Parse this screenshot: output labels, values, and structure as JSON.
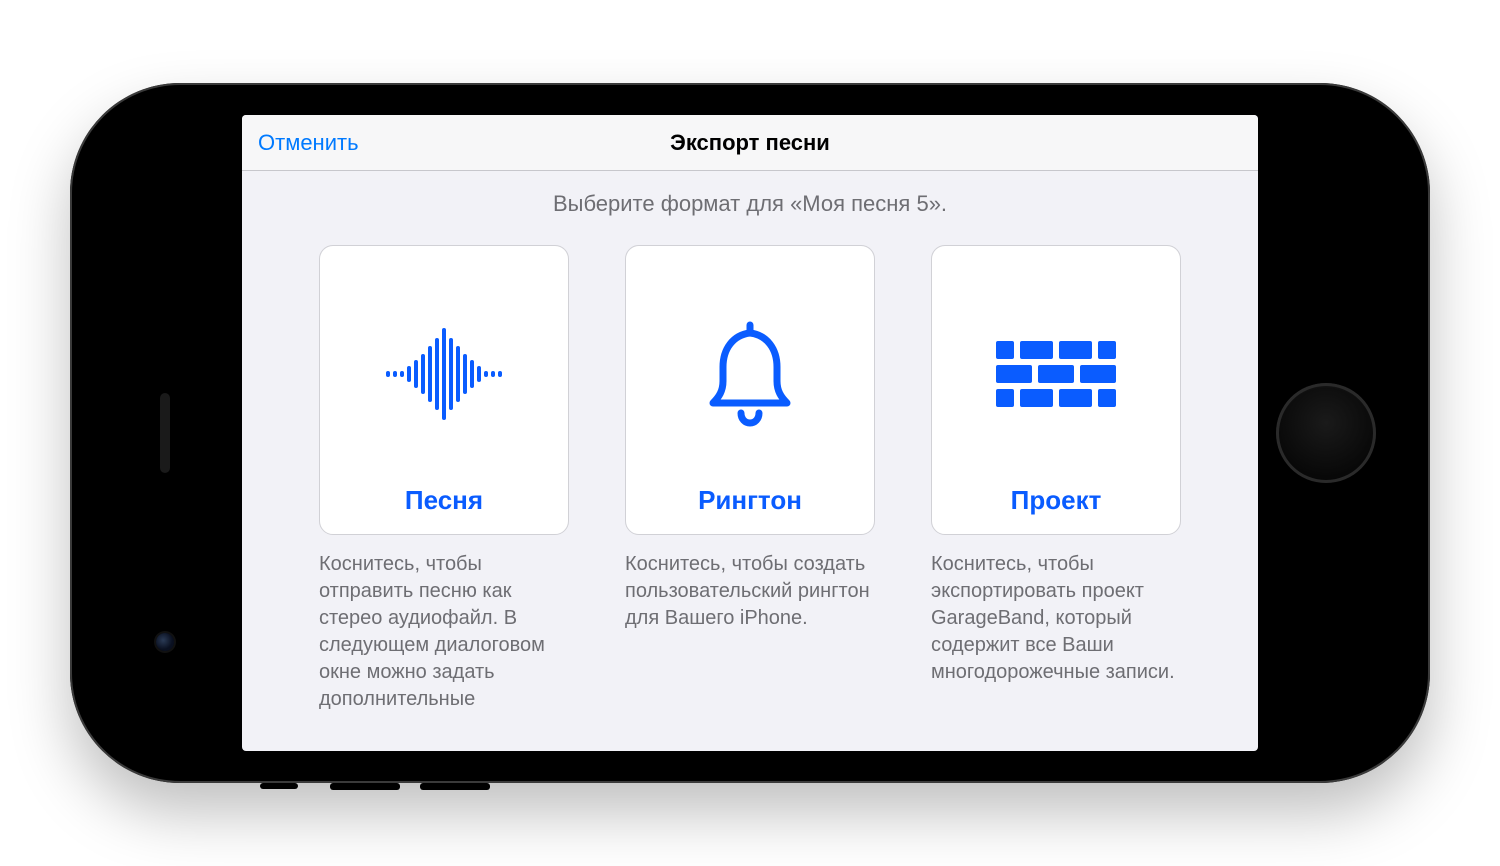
{
  "navbar": {
    "cancel": "Отменить",
    "title": "Экспорт песни"
  },
  "prompt": "Выберите формат для «Моя песня 5».",
  "options": [
    {
      "icon": "waveform-icon",
      "label": "Песня",
      "description": "Коснитесь, чтобы отправить песню как стерео аудиофайл. В следующем диалоговом окне можно задать дополнительные"
    },
    {
      "icon": "ringtone-icon",
      "label": "Рингтон",
      "description": "Коснитесь, чтобы создать пользовательский рингтон для Вашего iPhone."
    },
    {
      "icon": "project-icon",
      "label": "Проект",
      "description": "Коснитесь, чтобы экспортировать проект GarageBand, который содержит все Ваши многодорожечные записи."
    }
  ],
  "colors": {
    "accent": "#0a5cff"
  }
}
